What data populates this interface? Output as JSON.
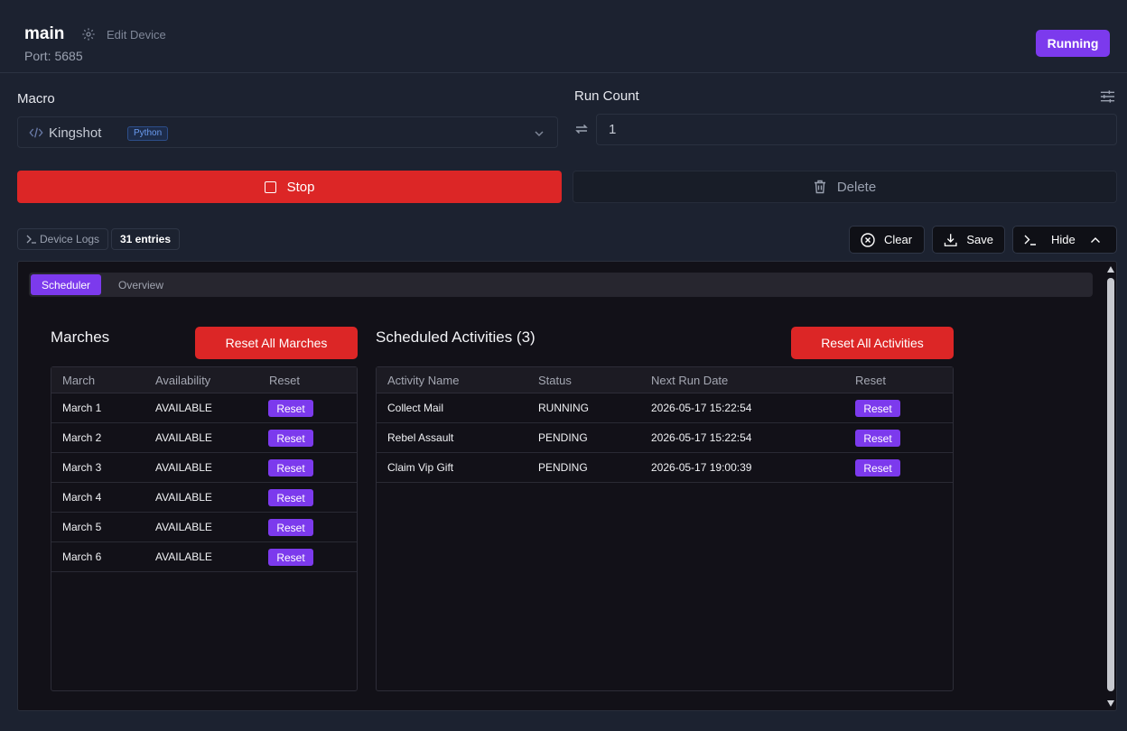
{
  "header": {
    "device_name": "main",
    "edit_label": "Edit Device",
    "port_label": "Port: 5685",
    "status": "Running"
  },
  "macro": {
    "label": "Macro",
    "selected": "Kingshot",
    "language": "Python"
  },
  "run_count": {
    "label": "Run Count",
    "value": "1"
  },
  "actions": {
    "stop": "Stop",
    "delete": "Delete"
  },
  "logs": {
    "device_logs_label": "Device Logs",
    "entries": "31 entries",
    "clear": "Clear",
    "save": "Save",
    "hide": "Hide"
  },
  "tabs": [
    "Scheduler",
    "Overview"
  ],
  "marches": {
    "title": "Marches",
    "reset_all": "Reset All Marches",
    "columns": [
      "March",
      "Availability",
      "Reset"
    ],
    "rows": [
      {
        "name": "March 1",
        "availability": "AVAILABLE",
        "action": "Reset"
      },
      {
        "name": "March 2",
        "availability": "AVAILABLE",
        "action": "Reset"
      },
      {
        "name": "March 3",
        "availability": "AVAILABLE",
        "action": "Reset"
      },
      {
        "name": "March 4",
        "availability": "AVAILABLE",
        "action": "Reset"
      },
      {
        "name": "March 5",
        "availability": "AVAILABLE",
        "action": "Reset"
      },
      {
        "name": "March 6",
        "availability": "AVAILABLE",
        "action": "Reset"
      }
    ]
  },
  "activities": {
    "title": "Scheduled Activities (3)",
    "reset_all": "Reset All Activities",
    "columns": [
      "Activity Name",
      "Status",
      "Next Run Date",
      "Reset"
    ],
    "rows": [
      {
        "name": "Collect Mail",
        "status": "RUNNING",
        "next_run": "2026-05-17 15:22:54",
        "action": "Reset"
      },
      {
        "name": "Rebel Assault",
        "status": "PENDING",
        "next_run": "2026-05-17 15:22:54",
        "action": "Reset"
      },
      {
        "name": "Claim Vip Gift",
        "status": "PENDING",
        "next_run": "2026-05-17 19:00:39",
        "action": "Reset"
      }
    ]
  },
  "colors": {
    "accent": "#7c3aed",
    "danger": "#dc2626",
    "background": "#1c2230",
    "panel": "#121118"
  }
}
